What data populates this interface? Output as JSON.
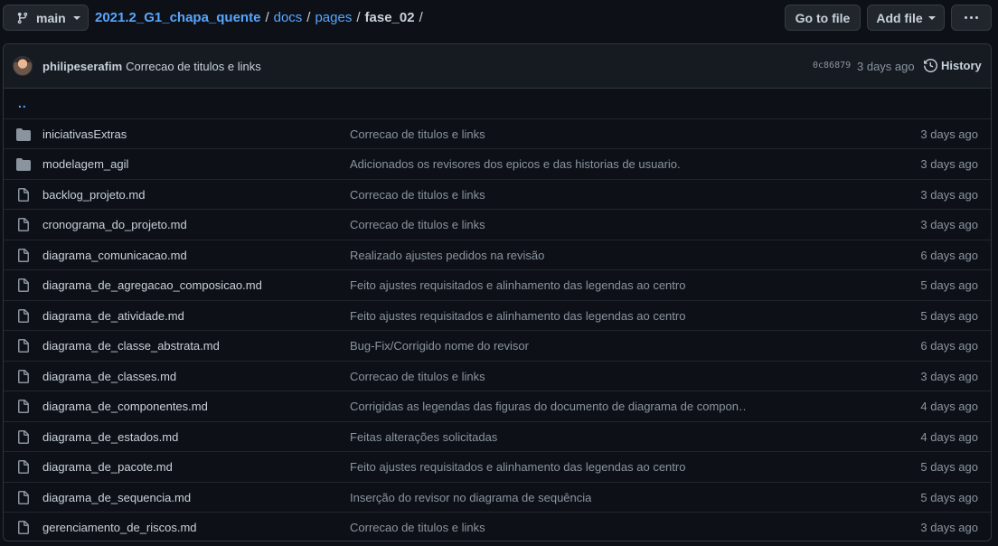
{
  "header": {
    "branch_label": "main",
    "breadcrumb": {
      "repo": "2021.2_G1_chapa_quente",
      "seg1": "docs",
      "seg2": "pages",
      "current": "fase_02",
      "sep": "/"
    },
    "goto_file_label": "Go to file",
    "add_file_label": "Add file"
  },
  "commit": {
    "author": "philipeserafim",
    "message": "Correcao de titulos e links",
    "sha": "0c86879",
    "age": "3 days ago",
    "history_label": "History"
  },
  "updir_label": "..",
  "files": [
    {
      "name": "iniciativasExtras",
      "type": "folder",
      "message": "Correcao de titulos e links",
      "age": "3 days ago"
    },
    {
      "name": "modelagem_agil",
      "type": "folder",
      "message": "Adicionados os revisores dos epicos e das historias de usuario.",
      "age": "3 days ago"
    },
    {
      "name": "backlog_projeto.md",
      "type": "file",
      "message": "Correcao de titulos e links",
      "age": "3 days ago"
    },
    {
      "name": "cronograma_do_projeto.md",
      "type": "file",
      "message": "Correcao de titulos e links",
      "age": "3 days ago"
    },
    {
      "name": "diagrama_comunicacao.md",
      "type": "file",
      "message": "Realizado ajustes pedidos na revisão",
      "age": "6 days ago"
    },
    {
      "name": "diagrama_de_agregacao_composicao.md",
      "type": "file",
      "message": "Feito ajustes requisitados e alinhamento das legendas ao centro",
      "age": "5 days ago"
    },
    {
      "name": "diagrama_de_atividade.md",
      "type": "file",
      "message": "Feito ajustes requisitados e alinhamento das legendas ao centro",
      "age": "5 days ago"
    },
    {
      "name": "diagrama_de_classe_abstrata.md",
      "type": "file",
      "message": "Bug-Fix/Corrigido nome do revisor",
      "age": "6 days ago"
    },
    {
      "name": "diagrama_de_classes.md",
      "type": "file",
      "message": "Correcao de titulos e links",
      "age": "3 days ago"
    },
    {
      "name": "diagrama_de_componentes.md",
      "type": "file",
      "message": "Corrigidas as legendas das figuras do documento de diagrama de compon…",
      "age": "4 days ago"
    },
    {
      "name": "diagrama_de_estados.md",
      "type": "file",
      "message": "Feitas alterações solicitadas",
      "age": "4 days ago"
    },
    {
      "name": "diagrama_de_pacote.md",
      "type": "file",
      "message": "Feito ajustes requisitados e alinhamento das legendas ao centro",
      "age": "5 days ago"
    },
    {
      "name": "diagrama_de_sequencia.md",
      "type": "file",
      "message": "Inserção do revisor no diagrama de sequência",
      "age": "5 days ago"
    },
    {
      "name": "gerenciamento_de_riscos.md",
      "type": "file",
      "message": "Correcao de titulos e links",
      "age": "3 days ago"
    }
  ],
  "colors": {
    "background": "#0d1117",
    "link": "#58a6ff",
    "muted": "#8b949e",
    "border": "#30363d"
  }
}
